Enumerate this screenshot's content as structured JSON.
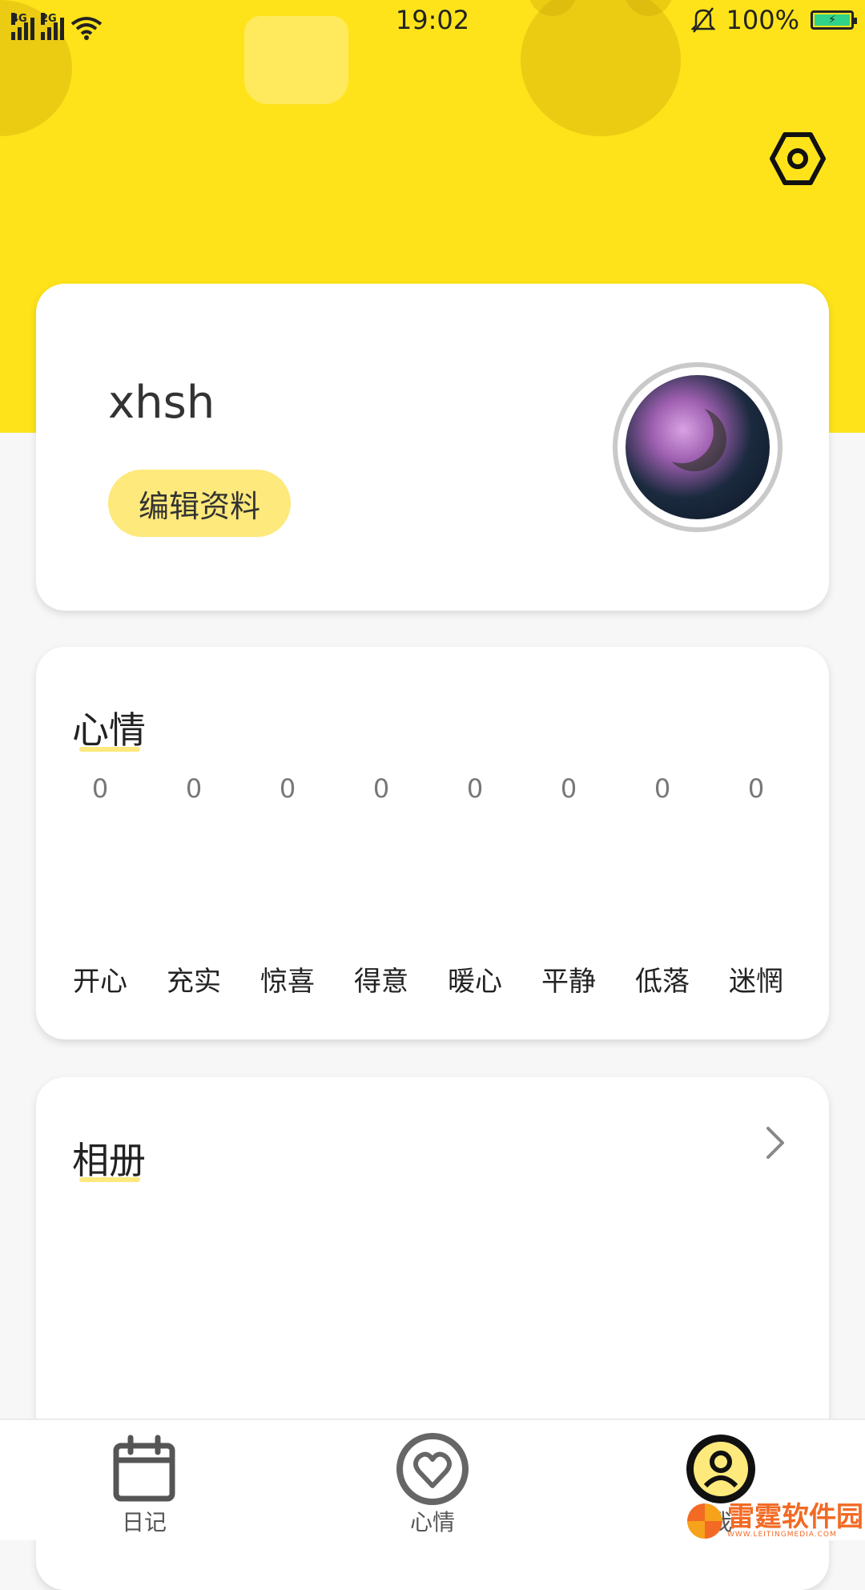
{
  "status_bar": {
    "network_1": "4G",
    "network_2": "2G",
    "time": "19:02",
    "battery": "100%"
  },
  "profile": {
    "username": "xhsh",
    "edit_label": "编辑资料"
  },
  "mood": {
    "title": "心情",
    "items": [
      {
        "label": "开心",
        "count": "0"
      },
      {
        "label": "充实",
        "count": "0"
      },
      {
        "label": "惊喜",
        "count": "0"
      },
      {
        "label": "得意",
        "count": "0"
      },
      {
        "label": "暖心",
        "count": "0"
      },
      {
        "label": "平静",
        "count": "0"
      },
      {
        "label": "低落",
        "count": "0"
      },
      {
        "label": "迷惘",
        "count": "0"
      }
    ]
  },
  "album": {
    "title": "相册"
  },
  "nav": {
    "items": [
      {
        "label": "日记",
        "icon": "calendar-icon"
      },
      {
        "label": "心情",
        "icon": "heart-icon"
      },
      {
        "label": "我",
        "icon": "user-icon"
      }
    ]
  },
  "watermark": {
    "text": "雷霆软件园",
    "sub": "WWW.LEITINGMEDIA.COM"
  },
  "colors": {
    "header": "#fee31a",
    "accent": "#fde97c"
  }
}
